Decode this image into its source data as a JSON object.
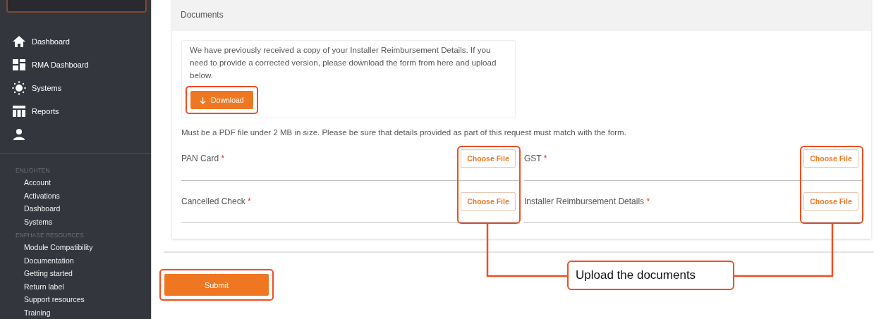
{
  "sidebar": {
    "nav": [
      "Dashboard",
      "RMA Dashboard",
      "Systems",
      "Reports"
    ],
    "sections": [
      {
        "heading": "ENLIGHTEN",
        "links": [
          "Account",
          "Activations",
          "Dashboard",
          "Systems"
        ]
      },
      {
        "heading": "ENPHASE RESOURCES",
        "links": [
          "Module Compatibility",
          "Documentation",
          "Getting started",
          "Return label",
          "Support resources",
          "Training"
        ]
      }
    ]
  },
  "panel": {
    "title": "Documents",
    "notice": {
      "text": "We have previously received a copy of your Installer Reimbursement Details. If you need to provide a corrected version, please download the form from here and upload below.",
      "button": {
        "label": "Download",
        "highlighted": true
      }
    },
    "help": "Must be a PDF file under 2 MB in size. Please be sure that details provided as part of this request must match with the form.",
    "columns": [
      {
        "highlighted": true,
        "fields": [
          {
            "label": "PAN Card",
            "required_mark": "*",
            "button": "Choose File"
          },
          {
            "label": "Cancelled Check",
            "required_mark": "*",
            "button": "Choose File"
          }
        ]
      },
      {
        "highlighted": true,
        "fields": [
          {
            "label": "GST",
            "required_mark": "*",
            "button": "Choose File"
          },
          {
            "label": "Installer Reimbursement Details",
            "required_mark": "*",
            "button": "Choose File"
          }
        ]
      }
    ]
  },
  "submit": {
    "label": "Submit",
    "highlighted": true
  },
  "callout": {
    "text": "Upload the documents"
  }
}
